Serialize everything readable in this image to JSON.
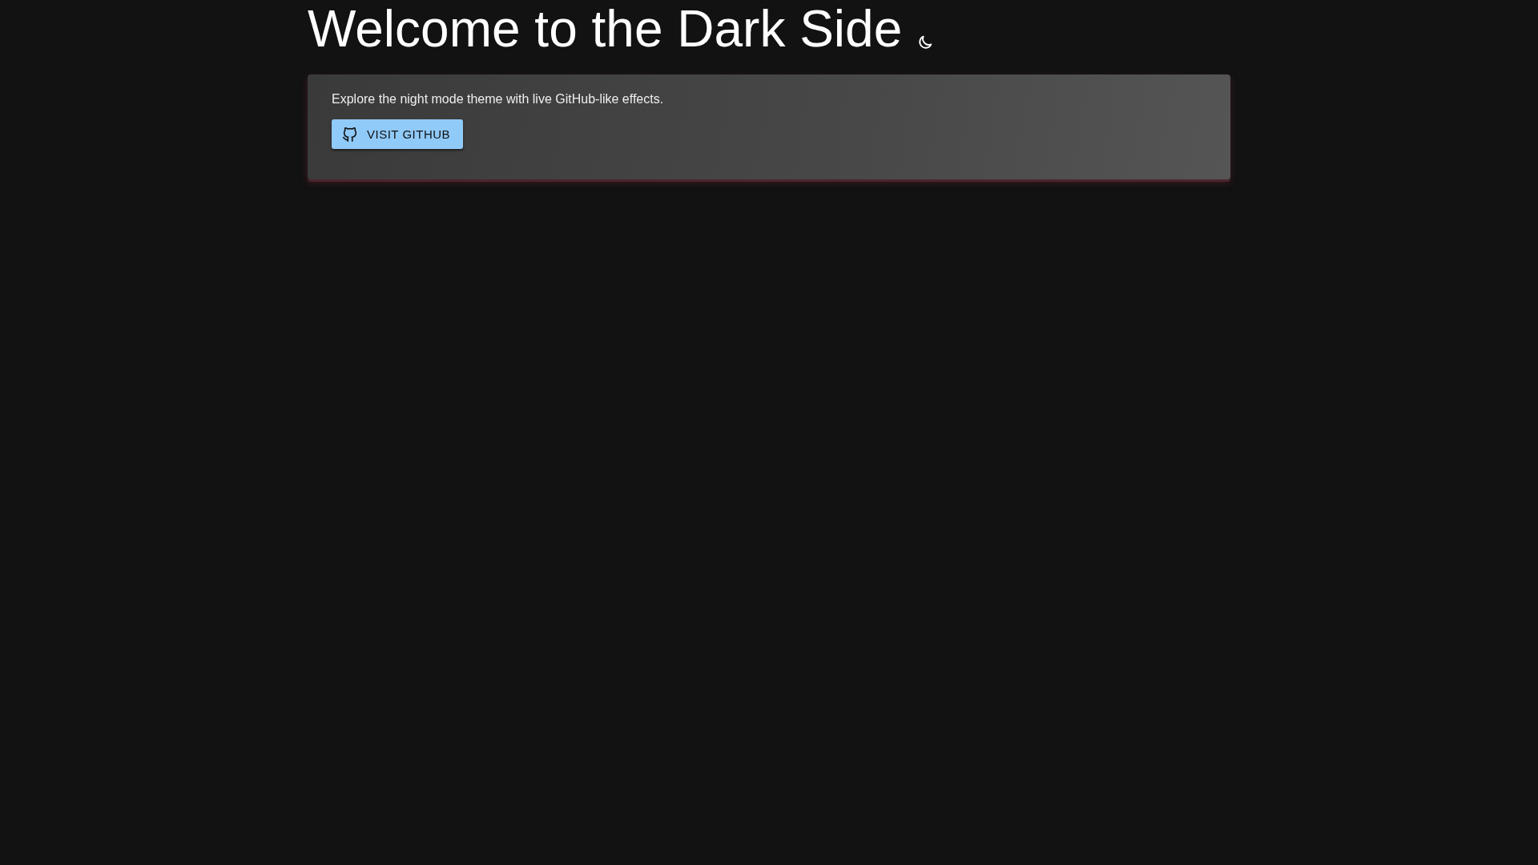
{
  "heading": {
    "title": "Welcome to the Dark Side"
  },
  "card": {
    "text": "Explore the night mode theme with live GitHub-like effects.",
    "button": "VISIT GITHUB"
  }
}
